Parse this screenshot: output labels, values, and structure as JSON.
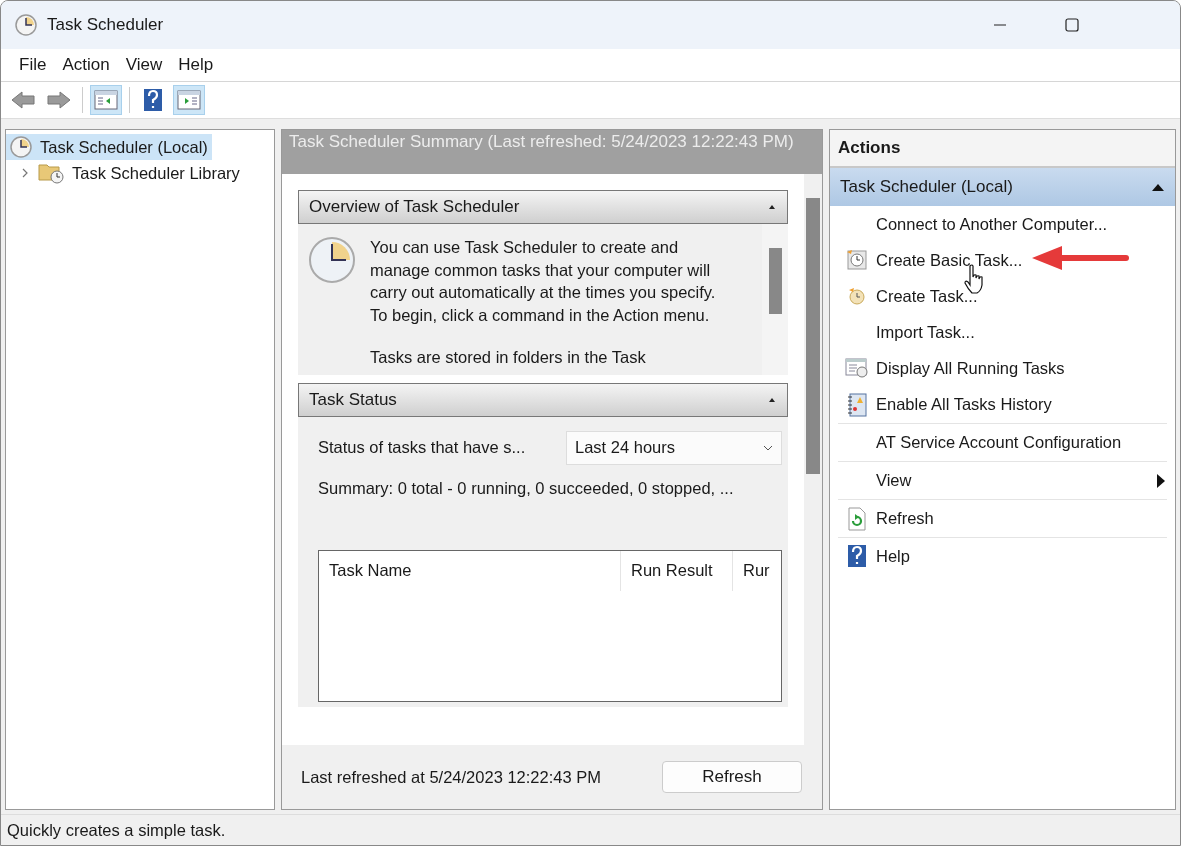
{
  "window": {
    "title": "Task Scheduler"
  },
  "menu": [
    "File",
    "Action",
    "View",
    "Help"
  ],
  "toolbar": [
    {
      "kind": "back",
      "disabled": true,
      "pressed": false
    },
    {
      "kind": "forward",
      "disabled": true,
      "pressed": false
    },
    {
      "kind": "tree-pane",
      "pressed": true
    },
    {
      "kind": "help",
      "pressed": false
    },
    {
      "kind": "action-pane",
      "pressed": true
    }
  ],
  "tree": [
    {
      "label": "Task Scheduler (Local)",
      "selected": true,
      "kind": "clock"
    },
    {
      "label": "Task Scheduler Library",
      "selected": false,
      "kind": "folder",
      "expanded": false
    }
  ],
  "summary": {
    "header": "Task Scheduler Summary (Last refreshed: 5/24/2023 12:22:43 PM)",
    "overview": {
      "title": "Overview of Task Scheduler",
      "expanded": true,
      "paragraphs": [
        "You can use Task Scheduler to create and manage common tasks that your computer will carry out automatically at the times you specify. To begin, click a command in the Action menu.",
        "Tasks are stored in folders in the Task"
      ]
    },
    "status": {
      "title": "Task Status",
      "expanded": true,
      "filter_label": "Status of tasks that have s...",
      "filter_value": "Last 24 hours",
      "summary": "Summary: 0 total - 0 running, 0 succeeded, 0 stopped, ...",
      "columns": [
        "Task Name",
        "Run Result",
        "Rur"
      ]
    },
    "footer": {
      "text": "Last refreshed at 5/24/2023 12:22:43 PM",
      "button": "Refresh"
    }
  },
  "actions": {
    "title": "Actions",
    "group": "Task Scheduler (Local)",
    "expanded": true,
    "items": [
      {
        "label": "Connect to Another Computer...",
        "kind": "plain",
        "divider": false
      },
      {
        "label": "Create Basic Task...",
        "kind": "basic-task",
        "divider": false
      },
      {
        "label": "Create Task...",
        "kind": "task",
        "divider": false
      },
      {
        "label": "Import Task...",
        "kind": "plain",
        "divider": false
      },
      {
        "label": "Display All Running Tasks",
        "kind": "running",
        "divider": false
      },
      {
        "label": "Enable All Tasks History",
        "kind": "history",
        "divider": true
      },
      {
        "label": "AT Service Account Configuration",
        "kind": "plain",
        "divider": true
      },
      {
        "label": "View",
        "kind": "submenu",
        "divider": true
      },
      {
        "label": "Refresh",
        "kind": "refresh",
        "divider": true
      },
      {
        "label": "Help",
        "kind": "help",
        "divider": false
      }
    ]
  },
  "status_bar": "Quickly creates a simple task."
}
